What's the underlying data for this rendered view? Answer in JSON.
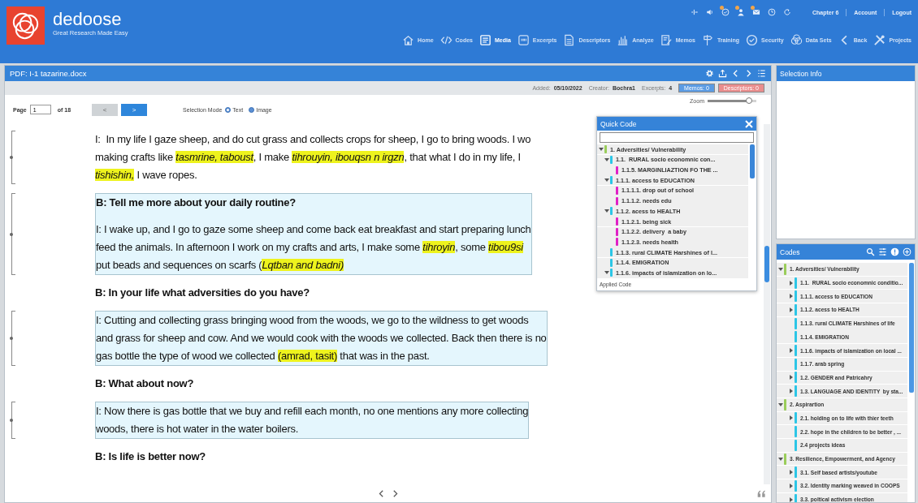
{
  "header": {
    "app_name": "dedoose",
    "tagline": "Great Research Made Easy",
    "status_icons": [
      {
        "badge": false
      },
      {
        "badge": false
      },
      {
        "badge": true
      },
      {
        "badge": true
      },
      {
        "badge": true
      },
      {
        "badge": false
      },
      {
        "badge": false
      }
    ],
    "links": [
      "Chapter 6",
      "Account",
      "Logout"
    ],
    "nav": [
      {
        "label": "Home",
        "selected": false
      },
      {
        "label": "Codes",
        "selected": false
      },
      {
        "label": "Media",
        "selected": true
      },
      {
        "label": "Excerpts",
        "selected": false
      },
      {
        "label": "Descriptors",
        "selected": false
      },
      {
        "label": "Analyze",
        "selected": false
      },
      {
        "label": "Memos",
        "selected": false
      },
      {
        "label": "Training",
        "selected": false
      },
      {
        "label": "Security",
        "selected": false
      },
      {
        "label": "Data Sets",
        "selected": false
      },
      {
        "label": "Back",
        "selected": false
      },
      {
        "label": "Projects",
        "selected": false
      }
    ]
  },
  "document": {
    "title": "PDF: I-1 tazarine.docx",
    "meta": [
      {
        "label": "Added:",
        "value": "05/10/2022"
      },
      {
        "label": "Creator:",
        "value": "Bochra1"
      },
      {
        "label": "Excerpts:",
        "value": "4"
      }
    ],
    "buttons": [
      {
        "label": "Memos: 0",
        "color": "#5b9be3"
      },
      {
        "label": "Descriptors: 0",
        "color": "#e98d8d"
      }
    ],
    "page": {
      "label": "Page",
      "value": "1",
      "total": "of 18"
    },
    "pager": [
      {
        "label": "<",
        "disabled": true
      },
      {
        "label": ">",
        "disabled": false
      }
    ],
    "selection_mode": {
      "label": "Selection Mode",
      "options": [
        {
          "label": "Text",
          "selected": true
        },
        {
          "label": "Image",
          "selected": false
        }
      ]
    },
    "zoom": {
      "label": "Zoom",
      "level": 0.85
    },
    "items": [
      {
        "bracket": true,
        "shaded": false,
        "paragraphs": [
          {
            "bold": false,
            "lines": [
              [
                {
                  "text": "I:  In my life I gaze sheep, and do cut grass and collects crops for sheep, I go to bring woods. I wo",
                  "highlighted": false
                }
              ],
              [
                {
                  "text": "making crafts like ",
                  "highlighted": false
                },
                {
                  "text": "*tasmrine, taboust*",
                  "highlighted": true
                },
                {
                  "text": ", I make ",
                  "highlighted": false
                },
                {
                  "text": "*tihrouyin, ibouqsn n irgzn*",
                  "highlighted": true
                },
                {
                  "text": ", that what I do in my life, I",
                  "highlighted": false
                }
              ],
              [
                {
                  "text": "*tishishin,*",
                  "highlighted": true
                },
                {
                  "text": " I wave ropes.",
                  "highlighted": false
                }
              ]
            ]
          }
        ]
      },
      {
        "bracket": true,
        "shaded": true,
        "paragraphs": [
          {
            "bold": true,
            "lines": [
              [
                {
                  "text": "B: Tell me more about your daily routine?",
                  "highlighted": false
                }
              ]
            ]
          },
          {
            "bold": false,
            "lines": [
              [
                {
                  "text": "I: I wake up, and I go to gaze some sheep and come back eat breakfast and start preparing lunch",
                  "highlighted": false
                }
              ],
              [
                {
                  "text": "feed the animals. In afternoon I work on my crafts and arts, I make some ",
                  "highlighted": false
                },
                {
                  "text": "*tihroyin*",
                  "highlighted": true
                },
                {
                  "text": ", some ",
                  "highlighted": false
                },
                {
                  "text": "*tibou9si*",
                  "highlighted": true
                }
              ],
              [
                {
                  "text": "put beads and sequences on scarfs (",
                  "highlighted": false
                },
                {
                  "text": "*Lqtban and badni)*",
                  "highlighted": true
                }
              ]
            ]
          }
        ]
      },
      {
        "bracket": false,
        "shaded": false,
        "paragraphs": [
          {
            "bold": true,
            "lines": [
              [
                {
                  "text": "B: In your life what adversities do you have?",
                  "highlighted": false
                }
              ]
            ]
          }
        ]
      },
      {
        "bracket": true,
        "shaded": true,
        "paragraphs": [
          {
            "bold": false,
            "lines": [
              [
                {
                  "text": "I: Cutting and collecting grass bringing wood from the woods, we go to the wildness to get woods",
                  "highlighted": false
                }
              ],
              [
                {
                  "text": "and grass for sheep and cow. And we would cook with the woods we collected. Back then there is no",
                  "highlighted": false
                }
              ],
              [
                {
                  "text": "gas bottle the type of wood we collected ",
                  "highlighted": false
                },
                {
                  "text": "(amrad, tasit)",
                  "highlighted": true
                },
                {
                  "text": " that was in the past.",
                  "highlighted": false
                }
              ]
            ]
          }
        ]
      },
      {
        "bracket": false,
        "shaded": false,
        "paragraphs": [
          {
            "bold": true,
            "lines": [
              [
                {
                  "text": "B: What about now?",
                  "highlighted": false
                }
              ]
            ]
          }
        ]
      },
      {
        "bracket": true,
        "shaded": true,
        "paragraphs": [
          {
            "bold": false,
            "lines": [
              [
                {
                  "text": "I: Now there is gas bottle that we buy and refill each month, no one mentions any more collecting",
                  "highlighted": false
                }
              ],
              [
                {
                  "text": "woods, there is hot water in the water boilers.",
                  "highlighted": false
                }
              ]
            ]
          }
        ]
      },
      {
        "bracket": false,
        "shaded": false,
        "paragraphs": [
          {
            "bold": true,
            "lines": [
              [
                {
                  "text": "B: Is life is better now?",
                  "highlighted": false
                }
              ]
            ]
          }
        ]
      }
    ]
  },
  "quick_code": {
    "title": "Quick Code",
    "footer": "Applied Code",
    "items": [
      {
        "label": "1. Adversities/ Vulnerability",
        "color": "#9acd5a",
        "kind": "branch",
        "expanded": true,
        "children": [
          {
            "label": "1.1.  RURAL socio economnic con...",
            "color": "#2cc6e6",
            "kind": "branch",
            "expanded": true,
            "children": [
              {
                "label": "1.1.5. MARGINLIAZTION FO THE ...",
                "color": "#e021c6",
                "kind": "leaf"
              }
            ]
          },
          {
            "label": "1.1.1. access to EDUCATION",
            "color": "#2cc6e6",
            "kind": "branch",
            "expanded": true,
            "children": [
              {
                "label": "1.1.1.1. drop out of school",
                "color": "#e021c6",
                "kind": "leaf"
              },
              {
                "label": "1.1.1.2. needs edu",
                "color": "#e021c6",
                "kind": "leaf"
              }
            ]
          },
          {
            "label": "1.1.2. acess to HEALTH",
            "color": "#2cc6e6",
            "kind": "branch",
            "expanded": true,
            "children": [
              {
                "label": "1.1.2.1. being sick",
                "color": "#e021c6",
                "kind": "leaf"
              },
              {
                "label": "1.1.2.2. delivery  a baby",
                "color": "#e021c6",
                "kind": "leaf"
              },
              {
                "label": "1.1.2.3. needs health",
                "color": "#e021c6",
                "kind": "leaf"
              }
            ]
          },
          {
            "label": "1.1.3. rural CLIMATE Harshines of l...",
            "color": "#2cc6e6",
            "kind": "leaf"
          },
          {
            "label": "1.1.4. EMIGRATION",
            "color": "#2cc6e6",
            "kind": "leaf"
          },
          {
            "label": "1.1.6. impacts of islamization on lo...",
            "color": "#2cc6e6",
            "kind": "branch",
            "expanded": true
          }
        ]
      }
    ]
  },
  "selection_info": {
    "title": "Selection Info"
  },
  "codes": {
    "title": "Codes",
    "items": [
      {
        "label": "1. Adversities/ Vulnerability",
        "color": "#9acd5a",
        "kind": "branch",
        "expanded": true,
        "children": [
          {
            "label": "1.1.  RURAL socio economnic conditio...",
            "color": "#2cc6e6",
            "kind": "branch",
            "expanded": false
          },
          {
            "label": "1.1.1. access to EDUCATION",
            "color": "#2cc6e6",
            "kind": "branch",
            "expanded": false
          },
          {
            "label": "1.1.2. acess to HEALTH",
            "color": "#2cc6e6",
            "kind": "branch",
            "expanded": false
          },
          {
            "label": "1.1.3. rural CLIMATE Harshines of life",
            "color": "#2cc6e6",
            "kind": "leaf"
          },
          {
            "label": "1.1.4. EMIGRATION",
            "color": "#2cc6e6",
            "kind": "leaf"
          },
          {
            "label": "1.1.6. impacts of islamization on local ...",
            "color": "#2cc6e6",
            "kind": "branch",
            "expanded": false
          },
          {
            "label": "1.1.7. arab spring",
            "color": "#2cc6e6",
            "kind": "leaf"
          },
          {
            "label": "1.2. GENDER and Patricahry",
            "color": "#2cc6e6",
            "kind": "branch",
            "expanded": false
          },
          {
            "label": "1.3. LANGUAGE AND IDENTITY  by sta...",
            "color": "#2cc6e6",
            "kind": "branch",
            "expanded": false
          }
        ]
      },
      {
        "label": "2. Aspirartion",
        "color": "#9acd5a",
        "kind": "branch",
        "expanded": true,
        "children": [
          {
            "label": "2.1. holding on to life with thier teeth",
            "color": "#2cc6e6",
            "kind": "branch",
            "expanded": false
          },
          {
            "label": "2.2. hope in the children to be better , ...",
            "color": "#2cc6e6",
            "kind": "leaf"
          },
          {
            "label": "2.4 projects ideas",
            "color": "#2cc6e6",
            "kind": "leaf"
          }
        ]
      },
      {
        "label": "3. Resilience, Empowerment, and Agency",
        "color": "#9acd5a",
        "kind": "branch",
        "expanded": true,
        "children": [
          {
            "label": "3.1. Self based artists/youtube",
            "color": "#2cc6e6",
            "kind": "branch",
            "expanded": false
          },
          {
            "label": "3.2. Identity marking weaved in COOPS",
            "color": "#2cc6e6",
            "kind": "branch",
            "expanded": false
          },
          {
            "label": "3.3. poltical activism election",
            "color": "#2cc6e6",
            "kind": "branch",
            "expanded": false
          }
        ]
      }
    ]
  }
}
